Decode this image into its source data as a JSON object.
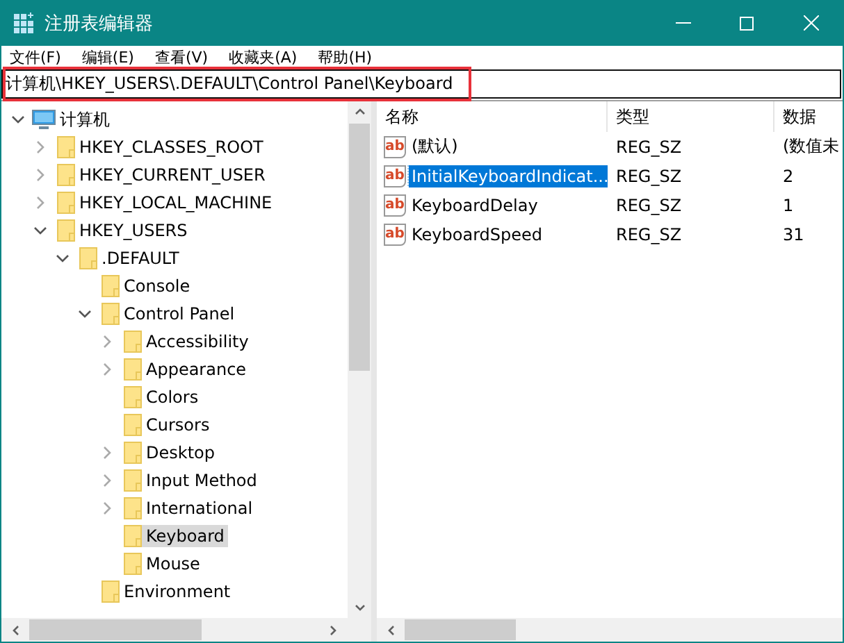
{
  "window": {
    "title": "注册表编辑器"
  },
  "menu": [
    "文件(F)",
    "编辑(E)",
    "查看(V)",
    "收藏夹(A)",
    "帮助(H)"
  ],
  "address": {
    "value": "计算机\\HKEY_USERS\\.DEFAULT\\Control Panel\\Keyboard",
    "highlighted": true
  },
  "tree": [
    {
      "label": "计算机",
      "kind": "computer",
      "expanded": true,
      "selected": false,
      "children": [
        {
          "label": "HKEY_CLASSES_ROOT",
          "kind": "branch",
          "expanded": false,
          "selected": false
        },
        {
          "label": "HKEY_CURRENT_USER",
          "kind": "branch",
          "expanded": false,
          "selected": false
        },
        {
          "label": "HKEY_LOCAL_MACHINE",
          "kind": "branch",
          "expanded": false,
          "selected": false
        },
        {
          "label": "HKEY_USERS",
          "kind": "branch",
          "expanded": true,
          "selected": false,
          "children": [
            {
              "label": ".DEFAULT",
              "kind": "branch",
              "expanded": true,
              "selected": false,
              "children": [
                {
                  "label": "Console",
                  "kind": "leaf",
                  "selected": false
                },
                {
                  "label": "Control Panel",
                  "kind": "branch",
                  "expanded": true,
                  "selected": false,
                  "children": [
                    {
                      "label": "Accessibility",
                      "kind": "branch",
                      "expanded": false,
                      "selected": false
                    },
                    {
                      "label": "Appearance",
                      "kind": "branch",
                      "expanded": false,
                      "selected": false
                    },
                    {
                      "label": "Colors",
                      "kind": "leaf",
                      "selected": false
                    },
                    {
                      "label": "Cursors",
                      "kind": "leaf",
                      "selected": false
                    },
                    {
                      "label": "Desktop",
                      "kind": "branch",
                      "expanded": false,
                      "selected": false
                    },
                    {
                      "label": "Input Method",
                      "kind": "branch",
                      "expanded": false,
                      "selected": false
                    },
                    {
                      "label": "International",
                      "kind": "branch",
                      "expanded": false,
                      "selected": false
                    },
                    {
                      "label": "Keyboard",
                      "kind": "leaf",
                      "selected": true
                    },
                    {
                      "label": "Mouse",
                      "kind": "leaf",
                      "selected": false
                    }
                  ]
                },
                {
                  "label": "Environment",
                  "kind": "leaf",
                  "selected": false
                }
              ]
            }
          ]
        }
      ]
    }
  ],
  "table": {
    "columns": [
      "名称",
      "类型",
      "数据"
    ],
    "rows": [
      {
        "icon": "ab",
        "name": "(默认)",
        "type": "REG_SZ",
        "data": "(数值未",
        "selected": false
      },
      {
        "icon": "ab",
        "name": "InitialKeyboardIndicat...",
        "type": "REG_SZ",
        "data": "2",
        "selected": true
      },
      {
        "icon": "ab",
        "name": "KeyboardDelay",
        "type": "REG_SZ",
        "data": "1",
        "selected": false
      },
      {
        "icon": "ab",
        "name": "KeyboardSpeed",
        "type": "REG_SZ",
        "data": "31",
        "selected": false
      }
    ]
  }
}
